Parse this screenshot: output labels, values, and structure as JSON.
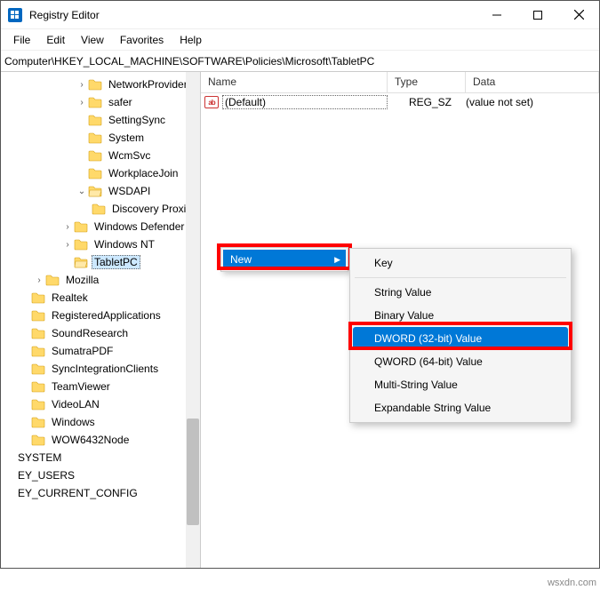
{
  "titlebar": {
    "title": "Registry Editor"
  },
  "menubar": {
    "items": [
      "File",
      "Edit",
      "View",
      "Favorites",
      "Help"
    ]
  },
  "addressbar": {
    "path": "Computer\\HKEY_LOCAL_MACHINE\\SOFTWARE\\Policies\\Microsoft\\TabletPC"
  },
  "tree": {
    "nodes": [
      {
        "indent": 4,
        "chev": "›",
        "label": "NetworkProvider"
      },
      {
        "indent": 4,
        "chev": "›",
        "label": "safer"
      },
      {
        "indent": 4,
        "chev": "",
        "label": "SettingSync"
      },
      {
        "indent": 4,
        "chev": "",
        "label": "System"
      },
      {
        "indent": 4,
        "chev": "",
        "label": "WcmSvc"
      },
      {
        "indent": 4,
        "chev": "",
        "label": "WorkplaceJoin"
      },
      {
        "indent": 4,
        "chev": "⌄",
        "label": "WSDAPI"
      },
      {
        "indent": 5,
        "chev": "",
        "label": "Discovery Proxies"
      },
      {
        "indent": 3,
        "chev": "›",
        "label": "Windows Defender"
      },
      {
        "indent": 3,
        "chev": "›",
        "label": "Windows NT"
      },
      {
        "indent": 3,
        "chev": "",
        "label": "TabletPC",
        "selected": true
      },
      {
        "indent": 1,
        "chev": "›",
        "label": "Mozilla"
      },
      {
        "indent": 0,
        "chev": "",
        "label": "Realtek"
      },
      {
        "indent": 0,
        "chev": "",
        "label": "RegisteredApplications"
      },
      {
        "indent": 0,
        "chev": "",
        "label": "SoundResearch"
      },
      {
        "indent": 0,
        "chev": "",
        "label": "SumatraPDF"
      },
      {
        "indent": 0,
        "chev": "",
        "label": "SyncIntegrationClients"
      },
      {
        "indent": 0,
        "chev": "",
        "label": "TeamViewer"
      },
      {
        "indent": 0,
        "chev": "",
        "label": "VideoLAN"
      },
      {
        "indent": 0,
        "chev": "",
        "label": "Windows"
      },
      {
        "indent": 0,
        "chev": "",
        "label": "WOW6432Node"
      },
      {
        "indent": -1,
        "chev": "",
        "label": "SYSTEM",
        "nofolder": true,
        "cut": true
      },
      {
        "indent": -1,
        "chev": "",
        "label": "EY_USERS",
        "nofolder": true,
        "cut": true
      },
      {
        "indent": -1,
        "chev": "",
        "label": "EY_CURRENT_CONFIG",
        "nofolder": true,
        "cut": true
      }
    ]
  },
  "list": {
    "headers": {
      "name": "Name",
      "type": "Type",
      "data": "Data"
    },
    "rows": [
      {
        "name": "(Default)",
        "type": "REG_SZ",
        "data": "(value not set)"
      }
    ]
  },
  "context_sub": {
    "label": "New"
  },
  "context_menu": {
    "items": [
      {
        "label": "Key"
      },
      null,
      {
        "label": "String Value"
      },
      {
        "label": "Binary Value"
      },
      {
        "label": "DWORD (32-bit) Value",
        "hl": true
      },
      {
        "label": "QWORD (64-bit) Value"
      },
      {
        "label": "Multi-String Value"
      },
      {
        "label": "Expandable String Value"
      }
    ]
  },
  "watermark": "wsxdn.com"
}
